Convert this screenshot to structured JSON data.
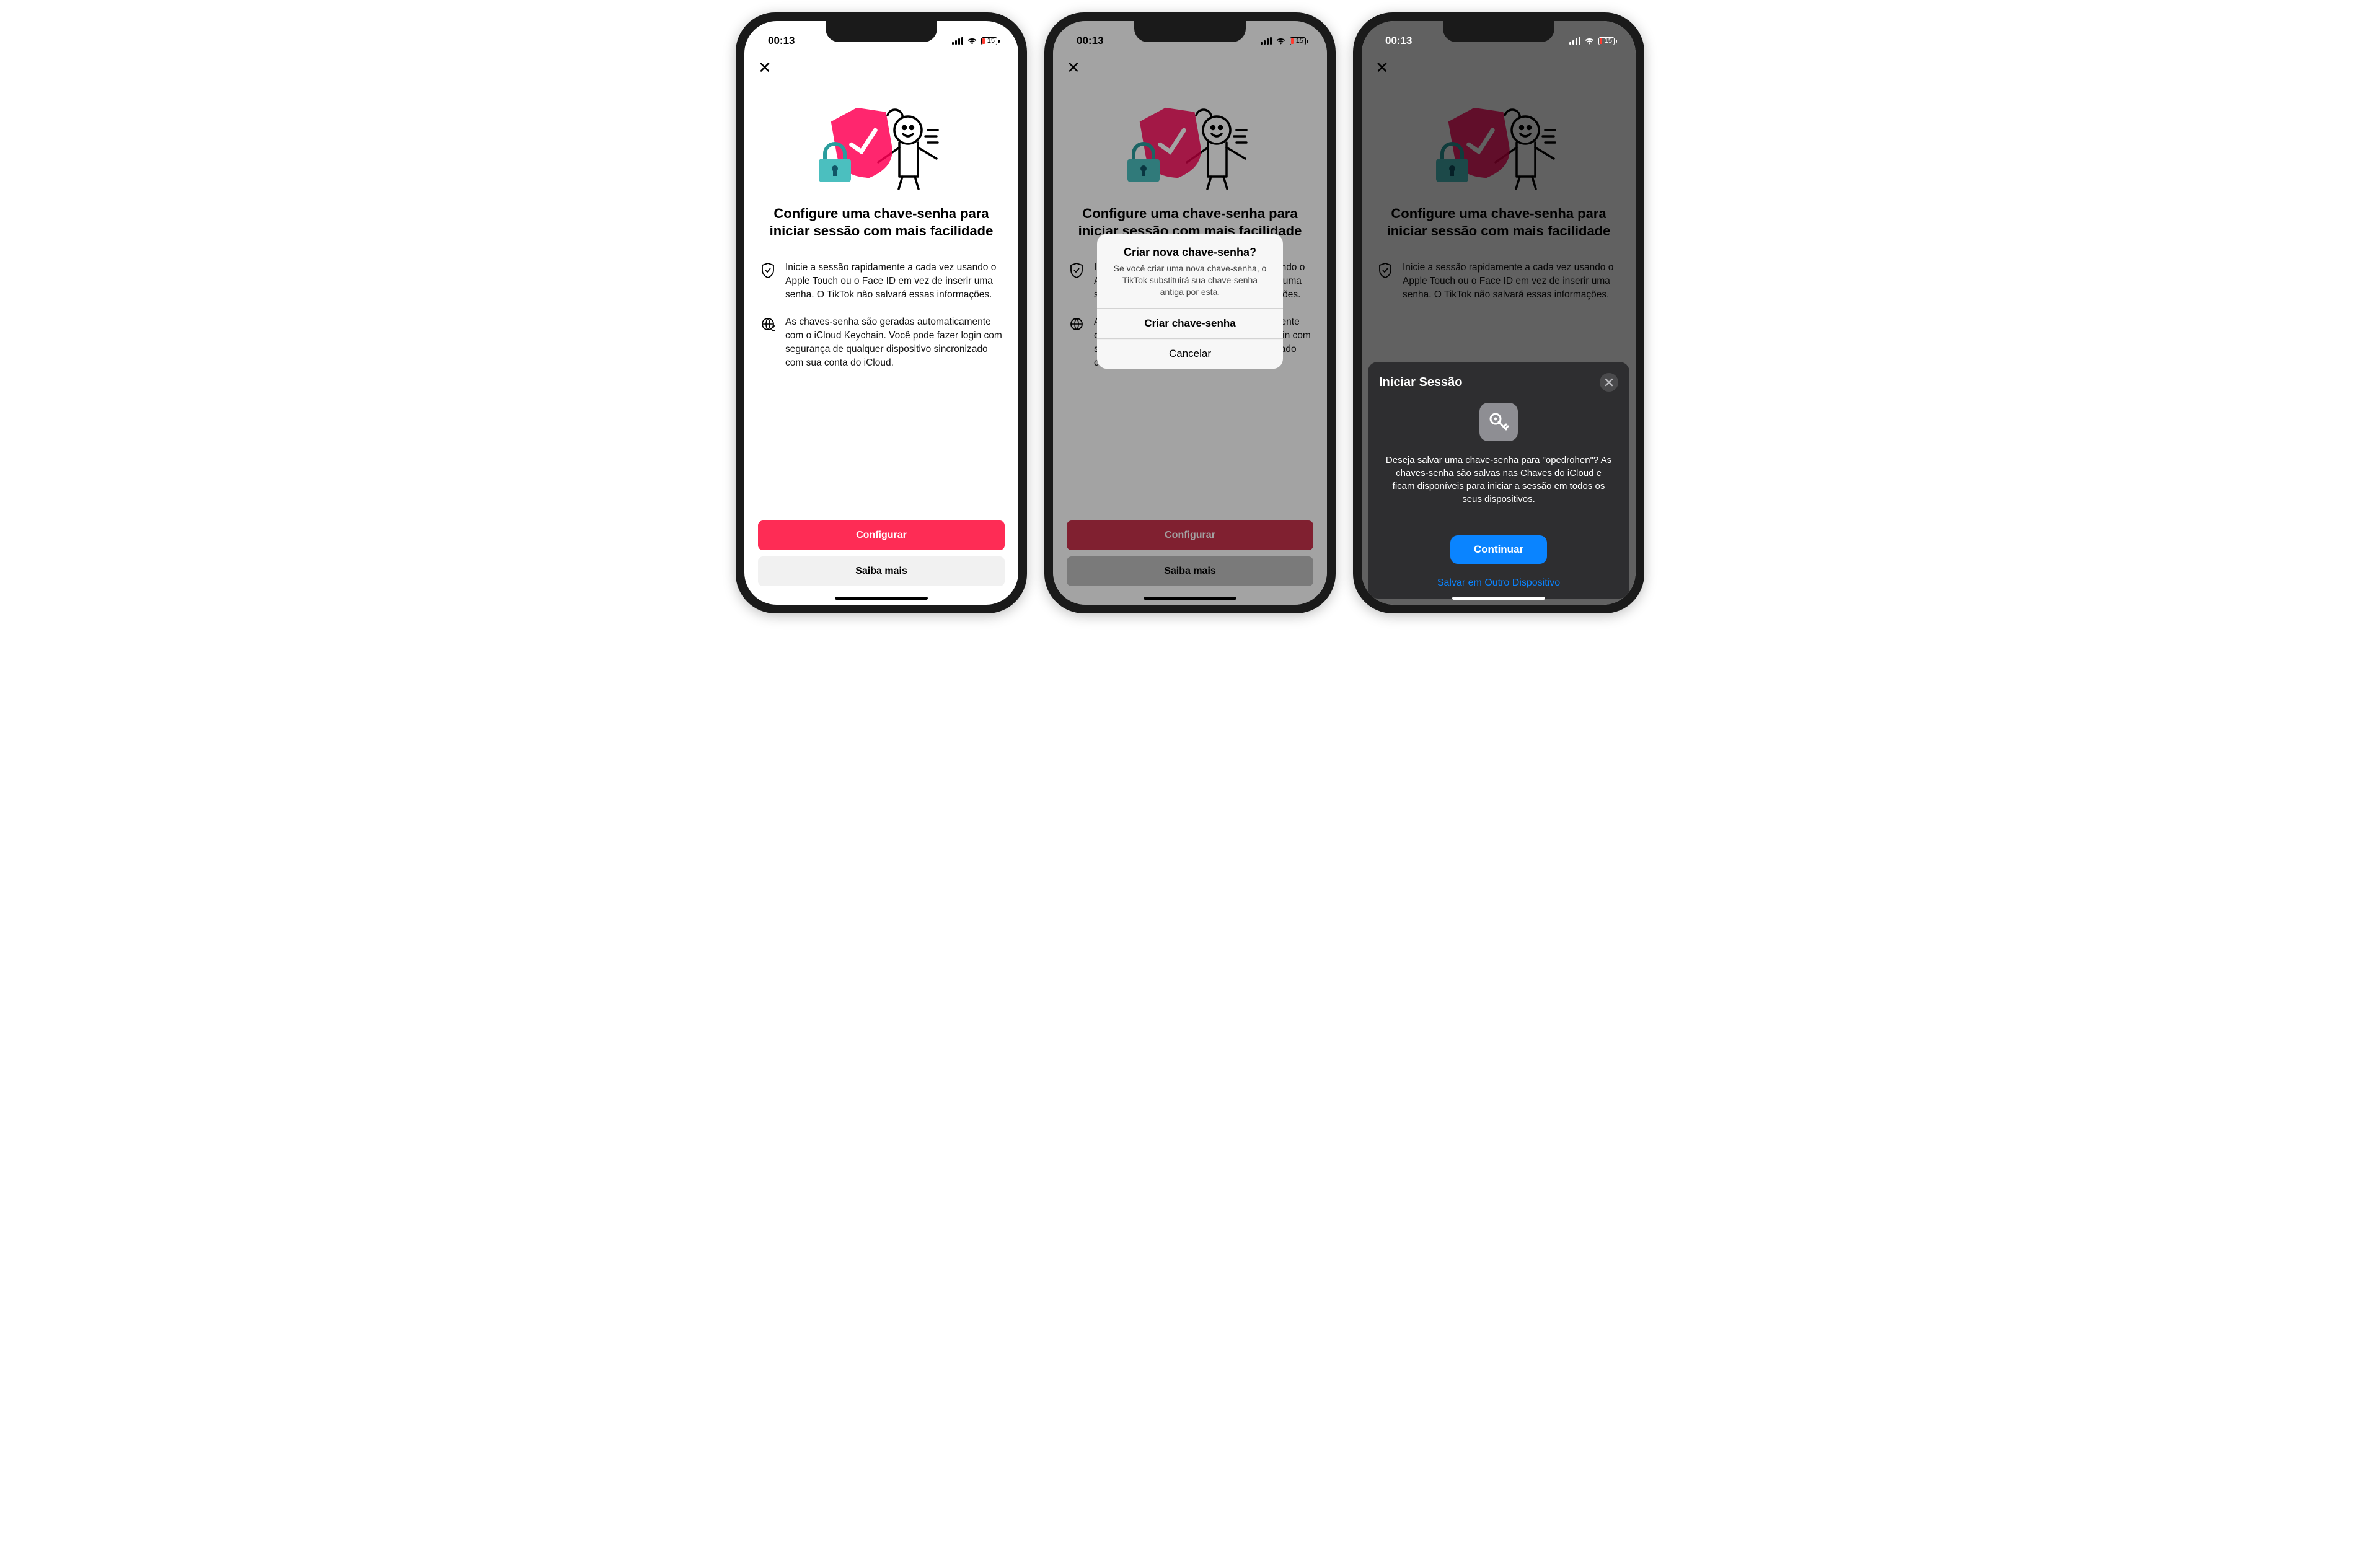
{
  "status": {
    "time": "00:13",
    "battery_pct": "15"
  },
  "passkey": {
    "title": "Configure uma chave-senha para iniciar sessão com mais facilidade",
    "bullet1": "Inicie a sessão rapidamente a cada vez usando o Apple Touch ou o Face ID em vez de inserir uma senha. O TikTok não salvará essas informações.",
    "bullet2": "As chaves-senha são geradas automaticamente com o iCloud Keychain. Você pode fazer login com segurança de qualquer dispositivo sincronizado com sua conta do iCloud.",
    "configure": "Configurar",
    "learn_more": "Saiba mais"
  },
  "alert": {
    "title": "Criar nova chave-senha?",
    "message": "Se você criar uma nova chave-senha, o TikTok substituirá sua chave-senha antiga por esta.",
    "create": "Criar chave-senha",
    "cancel": "Cancelar"
  },
  "sheet": {
    "title": "Iniciar Sessão",
    "body": "Deseja salvar uma chave-senha para \"opedrohen\"? As chaves-senha são salvas nas Chaves do iCloud e ficam disponíveis para iniciar a sessão em todos os seus dispositivos.",
    "continue": "Continuar",
    "other_device": "Salvar em Outro Dispositivo"
  }
}
